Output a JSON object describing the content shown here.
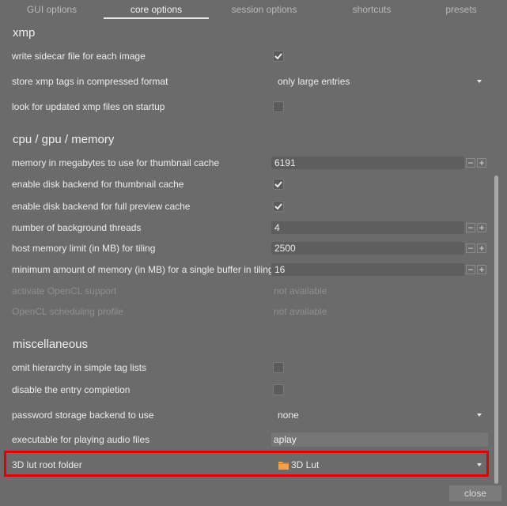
{
  "tabs": [
    {
      "label": "GUI options",
      "active": false
    },
    {
      "label": "core options",
      "active": true
    },
    {
      "label": "session options",
      "active": false
    },
    {
      "label": "shortcuts",
      "active": false
    },
    {
      "label": "presets",
      "active": false
    }
  ],
  "sections": {
    "xmp": {
      "title": "xmp",
      "write_sidecar": {
        "label": "write sidecar file for each image",
        "checked": true
      },
      "compressed": {
        "label": "store xmp tags in compressed format",
        "value": "only large entries"
      },
      "look_updated": {
        "label": "look for updated xmp files on startup",
        "checked": false
      }
    },
    "cpu": {
      "title": "cpu / gpu / memory",
      "thumb_cache_mem": {
        "label": "memory in megabytes to use for thumbnail cache",
        "value": "6191"
      },
      "disk_thumb": {
        "label": "enable disk backend for thumbnail cache",
        "checked": true
      },
      "disk_preview": {
        "label": "enable disk backend for full preview cache",
        "checked": true
      },
      "threads": {
        "label": "number of background threads",
        "value": "4"
      },
      "host_mem": {
        "label": "host memory limit (in MB) for tiling",
        "value": "2500"
      },
      "min_mem": {
        "label": "minimum amount of memory (in MB) for a single buffer in tiling",
        "value": "16"
      },
      "opencl": {
        "label": "activate OpenCL support",
        "value": "not available"
      },
      "opencl_profile": {
        "label": "OpenCL scheduling profile",
        "value": "not available"
      }
    },
    "misc": {
      "title": "miscellaneous",
      "omit_hierarchy": {
        "label": "omit hierarchy in simple tag lists",
        "checked": false
      },
      "disable_completion": {
        "label": "disable the entry completion",
        "checked": false
      },
      "password_backend": {
        "label": "password storage backend to use",
        "value": "none"
      },
      "audio_exec": {
        "label": "executable for playing audio files",
        "value": "aplay"
      },
      "lut_folder": {
        "label": "3D lut root folder",
        "value": "3D Lut"
      }
    }
  },
  "spin": {
    "minus": "−",
    "plus": "+"
  },
  "footer": {
    "close_label": "close"
  },
  "colors": {
    "highlight": "#e20000",
    "folder": "#f0a04a",
    "background": "#6b6b6b"
  },
  "icons": [
    "check-icon",
    "chevron-down-icon",
    "folder-icon",
    "minus-icon",
    "plus-icon"
  ]
}
